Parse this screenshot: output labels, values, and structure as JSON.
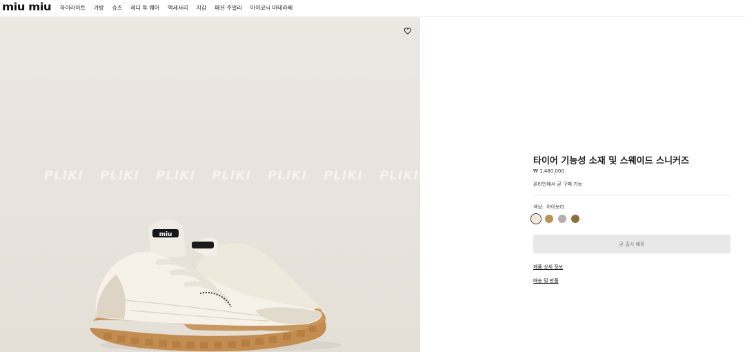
{
  "header": {
    "logo_text": "miu miu",
    "nav": [
      "하이라이트",
      "가방",
      "슈즈",
      "레디 투 웨어",
      "액세서리",
      "지갑",
      "패션 주얼리",
      "아이코닉 마테라쎄"
    ]
  },
  "image": {
    "watermark_text": "PLIKI",
    "wishlist_icon": "heart-outline-icon"
  },
  "product": {
    "title": "타이어 기능성 소재 및 스웨이드 스니커즈",
    "price": "₩ 1,480,000",
    "availability": "온라인에서 곧 구매 가능",
    "color_label": "색상:",
    "color_value": "아이보리",
    "swatches": [
      "#f3e6d3",
      "#b89450",
      "#b3b0ae",
      "#8f6e3d"
    ],
    "cta_label": "곧 출시 예정",
    "details_link": "제품 상세 정보",
    "shipping_link": "배송 및 반품"
  }
}
